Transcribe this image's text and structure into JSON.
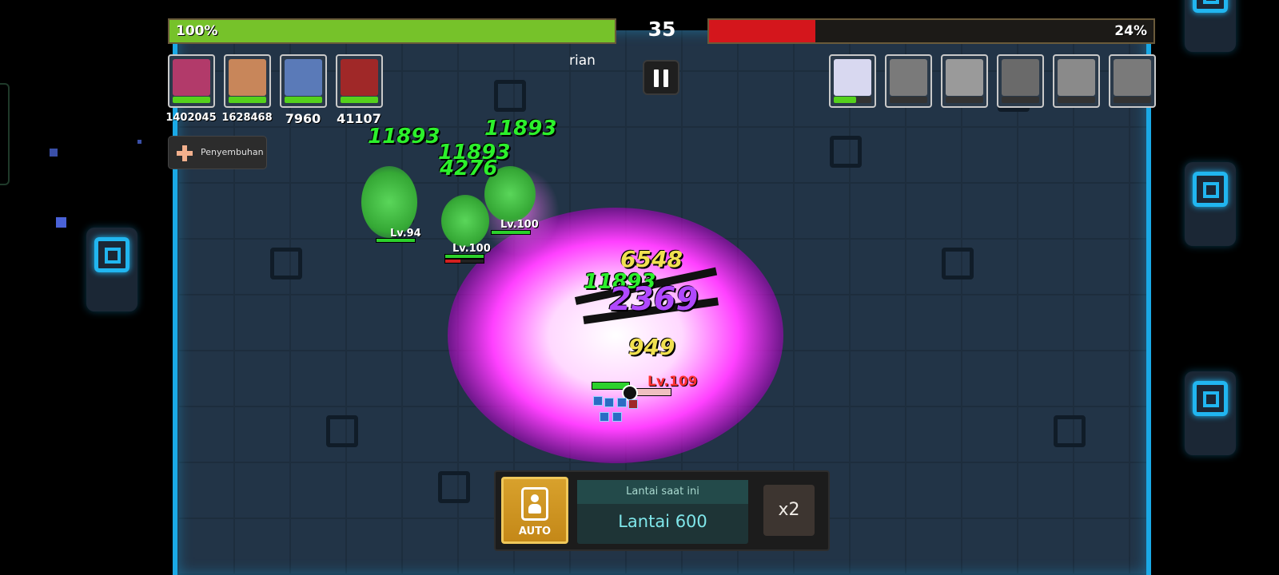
{
  "top_bar": {
    "team_hp_percent": "100%",
    "team_hp_fill": 1.0,
    "enemy_hp_percent": "24%",
    "enemy_hp_fill": 0.24,
    "timer": "35"
  },
  "player": {
    "name": "rian",
    "level": "109"
  },
  "team": [
    {
      "damage": "1402045",
      "hp": 1.0
    },
    {
      "damage": "1628468",
      "hp": 1.0
    },
    {
      "damage": "7960",
      "hp": 1.0
    },
    {
      "damage": "41107",
      "hp": 1.0
    }
  ],
  "enemies_portraits": [
    {
      "hp": 0.6,
      "active": true
    },
    {
      "hp": 0.0,
      "active": false
    },
    {
      "hp": 0.0,
      "active": false
    },
    {
      "hp": 0.0,
      "active": false
    },
    {
      "hp": 0.0,
      "active": false
    },
    {
      "hp": 0.0,
      "active": false
    }
  ],
  "skills": {
    "heal_label": "Penyembuhan"
  },
  "damage_numbers": [
    "11893",
    "11893",
    "11893",
    "4276",
    "6548",
    "11893",
    "2369",
    "949"
  ],
  "field_enemies": [
    {
      "level": "94"
    },
    {
      "level": "100"
    },
    {
      "level": "100"
    }
  ],
  "bottom": {
    "auto_label": "AUTO",
    "floor_title": "Lantai saat ini",
    "floor_value": "Lantai 600",
    "speed_label": "x2"
  },
  "colors": {
    "team_hp": "#76c22a",
    "enemy_hp": "#d4161c",
    "tile_border": "#1aa9e6",
    "auto_button": "#d8a12c"
  }
}
